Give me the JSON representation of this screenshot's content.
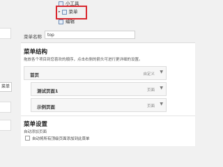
{
  "top_menu": {
    "items": [
      {
        "label": "小工具"
      },
      {
        "label": "菜单"
      },
      {
        "label": "编辑"
      }
    ]
  },
  "menu_name": {
    "label": "菜单名称",
    "value": "top"
  },
  "structure": {
    "heading": "菜单结构",
    "description": "拖放各个项目到您喜欢的顺序，点击右侧的箭头可进行更详细的设置。",
    "items": [
      {
        "title": "首页",
        "type": "自定义"
      },
      {
        "title": "测试页面1",
        "type": "页面"
      },
      {
        "title": "示例页面",
        "type": "页面"
      }
    ]
  },
  "settings": {
    "heading": "菜单设置",
    "auto_add_label": "自动添加页面",
    "auto_add_checkbox_label": "自动将所有顶级页面添加到此菜单"
  },
  "sidebar": {
    "button_label": "菜单"
  },
  "colors": {
    "highlight": "#d9272e",
    "panel": "#ffffff",
    "background": "#f1f1f1"
  }
}
